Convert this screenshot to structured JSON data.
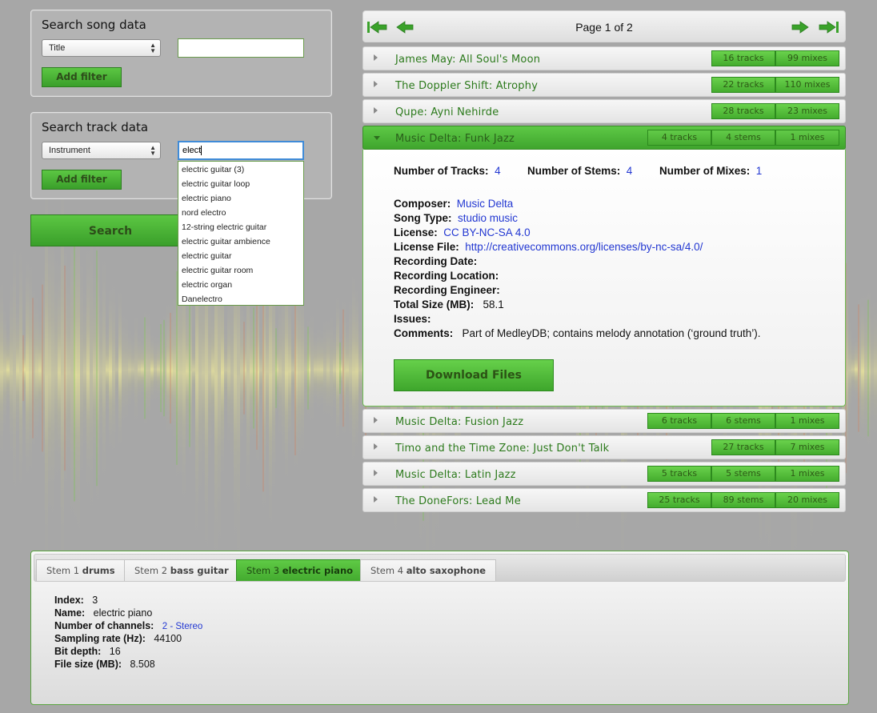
{
  "song_search": {
    "title": "Search song data",
    "field_selected": "Title",
    "query": "",
    "add_filter_label": "Add filter"
  },
  "track_search": {
    "title": "Search track data",
    "field_selected": "Instrument",
    "query": "elect",
    "add_filter_label": "Add filter",
    "suggestions": [
      "electric guitar (3)",
      "electric guitar loop",
      "electric piano",
      "nord electro",
      "12-string electric guitar",
      "electric guitar ambience",
      "electric guitar",
      "electric guitar room",
      "electric organ",
      "Danelectro"
    ]
  },
  "search_button_label": "Search",
  "pager": {
    "text": "Page 1 of 2"
  },
  "songs": [
    {
      "title": "James May: All Soul's Moon",
      "badges": [
        "16 tracks",
        "99 mixes"
      ]
    },
    {
      "title": "The Doppler Shift: Atrophy",
      "badges": [
        "22 tracks",
        "110 mixes"
      ]
    },
    {
      "title": "Qupe: Ayni Nehirde",
      "badges": [
        "28 tracks",
        "23 mixes"
      ]
    },
    {
      "title": "Music Delta: Funk Jazz",
      "badges": [
        "4 tracks",
        "4 stems",
        "1 mixes"
      ]
    },
    {
      "title": "Music Delta: Fusion Jazz",
      "badges": [
        "6 tracks",
        "6 stems",
        "1 mixes"
      ]
    },
    {
      "title": "Timo and the Time Zone: Just Don't Talk",
      "badges": [
        "27 tracks",
        "7 mixes"
      ]
    },
    {
      "title": "Music Delta: Latin Jazz",
      "badges": [
        "5 tracks",
        "5 stems",
        "1 mixes"
      ]
    },
    {
      "title": "The DoneFors: Lead Me",
      "badges": [
        "25 tracks",
        "89 stems",
        "20 mixes"
      ]
    }
  ],
  "details": {
    "num_tracks_label": "Number of Tracks:",
    "num_tracks": "4",
    "num_stems_label": "Number of Stems:",
    "num_stems": "4",
    "num_mixes_label": "Number of Mixes:",
    "num_mixes": "1",
    "composer_label": "Composer:",
    "composer": "Music Delta",
    "song_type_label": "Song Type:",
    "song_type": "studio music",
    "license_label": "License:",
    "license": "CC BY-NC-SA 4.0",
    "license_file_label": "License File:",
    "license_file": "http://creativecommons.org/licenses/by-nc-sa/4.0/",
    "recording_date_label": "Recording Date:",
    "recording_location_label": "Recording Location:",
    "recording_engineer_label": "Recording Engineer:",
    "total_size_label": "Total Size (MB):",
    "total_size": "58.1",
    "issues_label": "Issues:",
    "comments_label": "Comments:",
    "comments": "Part of MedleyDB; contains melody annotation (‘ground truth’).",
    "download_label": "Download Files"
  },
  "stems": {
    "tabs": [
      {
        "prefix": "Stem 1",
        "name": "drums"
      },
      {
        "prefix": "Stem 2",
        "name": "bass guitar"
      },
      {
        "prefix": "Stem 3",
        "name": "electric piano"
      },
      {
        "prefix": "Stem 4",
        "name": "alto saxophone"
      }
    ],
    "active_tab": 2,
    "info": {
      "index_label": "Index:",
      "index": "3",
      "name_label": "Name:",
      "name": "electric piano",
      "channels_label": "Number of channels:",
      "channels": "2 - Stereo",
      "sampling_label": "Sampling rate (Hz):",
      "sampling": "44100",
      "bitdepth_label": "Bit depth:",
      "bitdepth": "16",
      "filesize_label": "File size (MB):",
      "filesize": "8.508"
    }
  },
  "colors": {
    "accent": "#44ac2e",
    "link": "#2338d2"
  }
}
